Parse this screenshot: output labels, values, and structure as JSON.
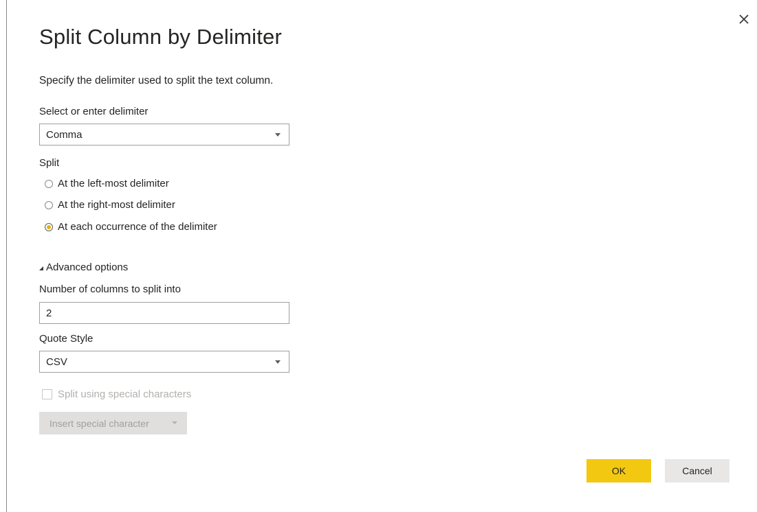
{
  "dialog": {
    "title": "Split Column by Delimiter",
    "description": "Specify the delimiter used to split the text column."
  },
  "delimiter": {
    "label": "Select or enter delimiter",
    "value": "Comma"
  },
  "split": {
    "label": "Split",
    "options": [
      {
        "label": "At the left-most delimiter",
        "selected": false
      },
      {
        "label": "At the right-most delimiter",
        "selected": false
      },
      {
        "label": "At each occurrence of the delimiter",
        "selected": true
      }
    ]
  },
  "advanced": {
    "toggle_label": "Advanced options",
    "columns_label": "Number of columns to split into",
    "columns_value": "2",
    "quote_label": "Quote Style",
    "quote_value": "CSV",
    "special_chars_label": "Split using special characters",
    "special_chars_checked": false,
    "insert_label": "Insert special character"
  },
  "buttons": {
    "ok": "OK",
    "cancel": "Cancel"
  },
  "colors": {
    "accent": "#f2c811",
    "radio_selected": "#e8b10a"
  },
  "icons": {
    "close": "close-icon",
    "dropdown": "chevron-down-icon",
    "expand": "triangle-expanded-icon"
  }
}
